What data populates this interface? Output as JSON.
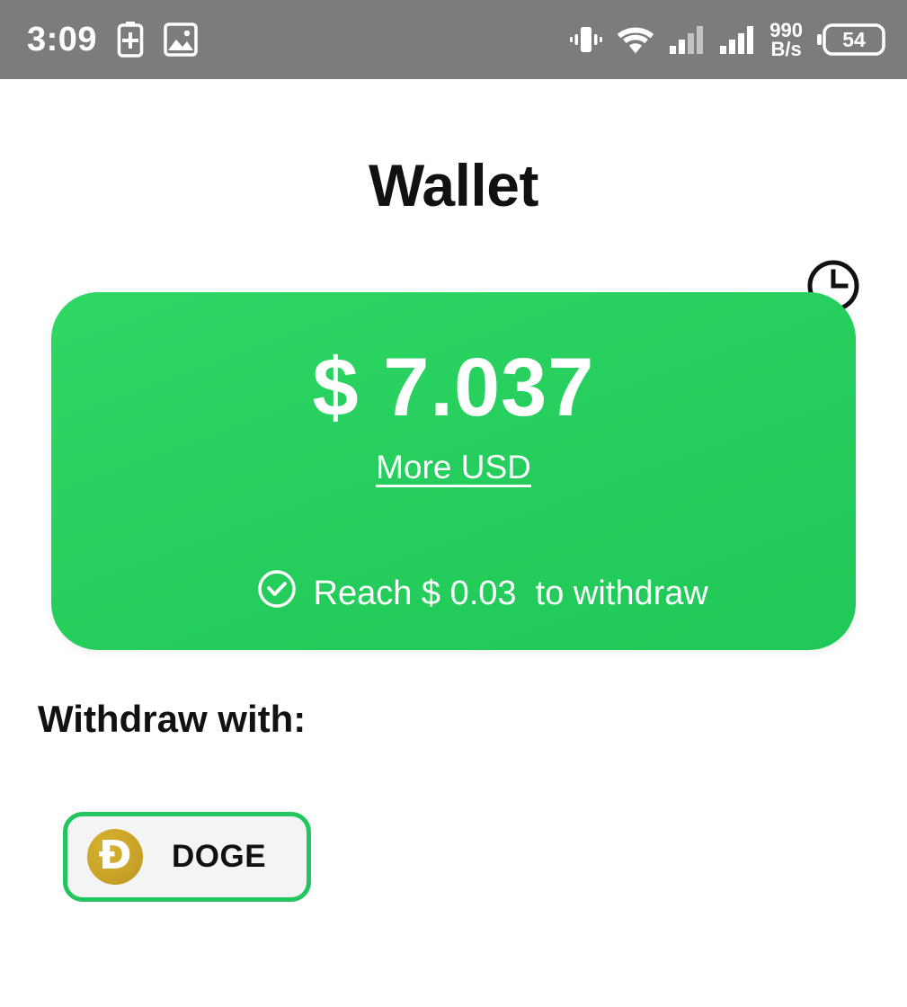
{
  "status_bar": {
    "time": "3:09",
    "network_speed_value": "990",
    "network_speed_unit": "B/s",
    "battery_level": "54",
    "background_color": "#7c7c7c",
    "icons": [
      "battery-saver-icon",
      "screenshot-image-icon",
      "vibrate-icon",
      "wifi-icon",
      "signal-sim1-icon",
      "signal-sim2-icon",
      "battery-icon"
    ]
  },
  "header": {
    "title": "Wallet",
    "history_icon": "clock-history-icon"
  },
  "balance_card": {
    "amount": "$ 7.037",
    "more_link": "More USD",
    "threshold_icon": "check-circle-icon",
    "threshold_text": "Reach $ 0.03  to withdraw",
    "accent_color": "#25ce5c"
  },
  "withdraw": {
    "label": "Withdraw with:",
    "methods": [
      {
        "name": "DOGE",
        "icon": "doge-coin-icon",
        "glyph": "Ð",
        "coin_color": "#c9a227",
        "border_color": "#22c55e"
      }
    ]
  }
}
